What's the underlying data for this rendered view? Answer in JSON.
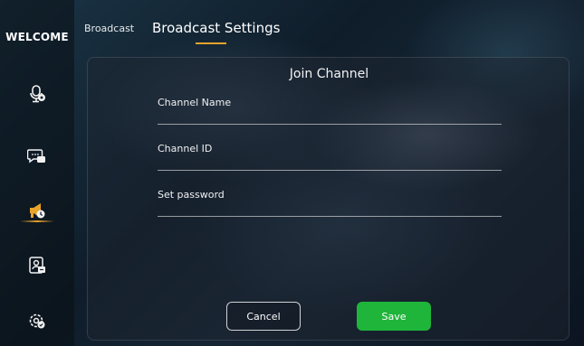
{
  "sidebar": {
    "brand": "WELCOME",
    "items": [
      {
        "icon": "microphone-settings-icon",
        "active": false
      },
      {
        "icon": "chat-bubbles-icon",
        "active": false
      },
      {
        "icon": "broadcast-megaphone-icon",
        "active": true
      },
      {
        "icon": "id-card-icon",
        "active": false
      },
      {
        "icon": "gear-settings-icon",
        "active": false
      }
    ]
  },
  "tabs": {
    "broadcast": "Broadcast",
    "settings": "Broadcast Settings"
  },
  "panel": {
    "title": "Join Channel",
    "fields": [
      {
        "label": "Channel Name",
        "value": ""
      },
      {
        "label": "Channel ID",
        "value": ""
      },
      {
        "label": "Set password",
        "value": ""
      }
    ],
    "cancel_label": "Cancel",
    "save_label": "Save"
  },
  "colors": {
    "accent": "#e8a32a",
    "save": "#1fb53a"
  }
}
